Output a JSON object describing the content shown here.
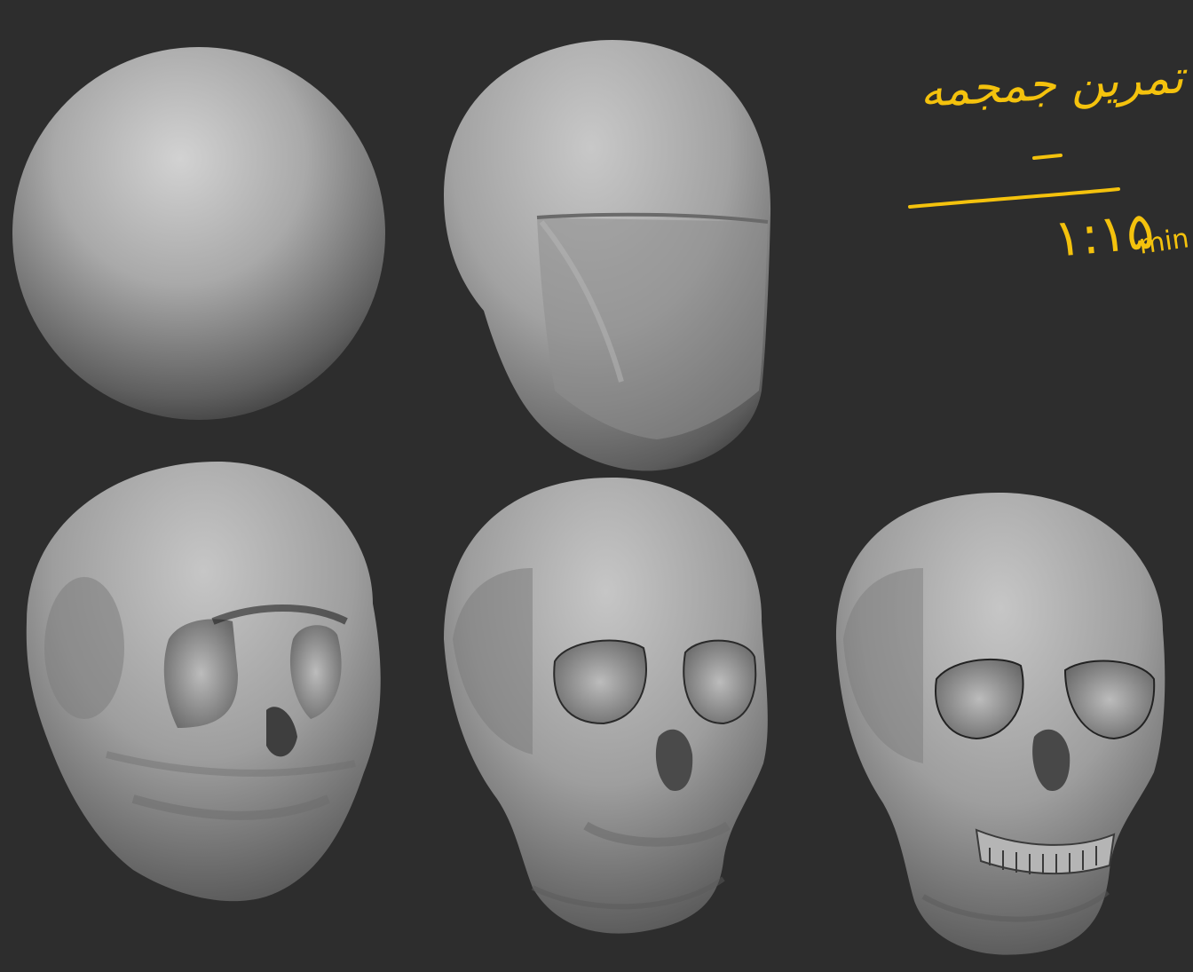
{
  "canvas": {
    "background": "#2d2d2d"
  },
  "annotation": {
    "title": "تمرین جمجمه",
    "duration": "۱:۱۵",
    "unit": "min",
    "color": "#f4c20d"
  },
  "stages": [
    {
      "id": "sphere",
      "label": ""
    },
    {
      "id": "head-block",
      "label": ""
    },
    {
      "id": "rough-skull",
      "label": ""
    },
    {
      "id": "refined-skull",
      "label": ""
    },
    {
      "id": "final-skull",
      "label": ""
    }
  ]
}
